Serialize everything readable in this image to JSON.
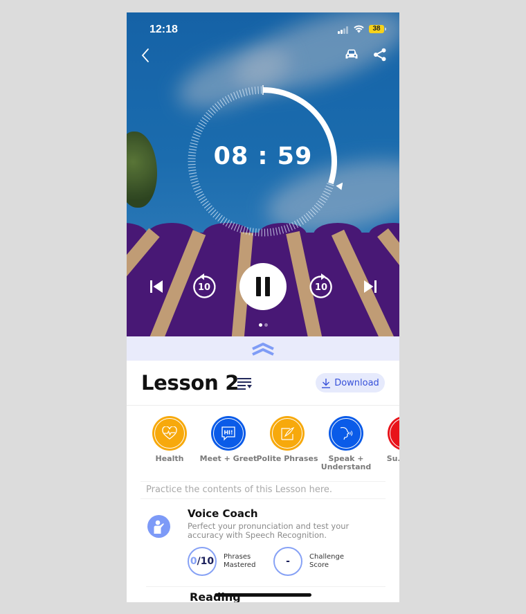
{
  "status_bar": {
    "time": "12:18",
    "battery": "38"
  },
  "header": {
    "back_icon": "chevron-left-icon",
    "car_mode_icon": "car-icon",
    "share_icon": "share-icon"
  },
  "player": {
    "timer": "08 : 59",
    "progress_fraction": 0.3,
    "controls": {
      "previous_icon": "skip-previous-icon",
      "rewind_label": "10",
      "pause_icon": "pause-icon",
      "forward_label": "10",
      "next_icon": "skip-next-icon"
    },
    "page_dots": {
      "count": 2,
      "active": 0
    }
  },
  "sheet": {
    "expand_icon": "double-chevron-up-icon",
    "lesson_title": "Lesson 2",
    "download_label": "Download",
    "topics": [
      {
        "label": "Health",
        "color": "#f7a90c",
        "icon": "heart-pulse-icon"
      },
      {
        "label": "Meet + Greet",
        "color": "#0a5be8",
        "icon": "speech-bubble-hi-icon"
      },
      {
        "label": "Polite Phrases",
        "color": "#f7a90c",
        "icon": "writing-icon"
      },
      {
        "label": "Speak + Understand",
        "color": "#0a5be8",
        "icon": "speaking-head-icon"
      },
      {
        "label": "Su... S...",
        "color": "#e8131a",
        "icon": "partial-icon"
      }
    ],
    "practice_hint": "Practice the contents of this Lesson here.",
    "voice_coach": {
      "title": "Voice Coach",
      "description": "Perfect your pronunciation and test your accuracy with Speech Recognition.",
      "phrases_mastered": {
        "done": "0",
        "total": "/10",
        "label_line1": "Phrases",
        "label_line2": "Mastered"
      },
      "challenge_score": {
        "value": "-",
        "label_line1": "Challenge",
        "label_line2": "Score"
      }
    },
    "next_section_title": "Reading"
  },
  "colors": {
    "accent_blue": "#3650d9",
    "light_accent": "#86a1f5",
    "sheet_handle_bg": "#e9ebfb"
  }
}
